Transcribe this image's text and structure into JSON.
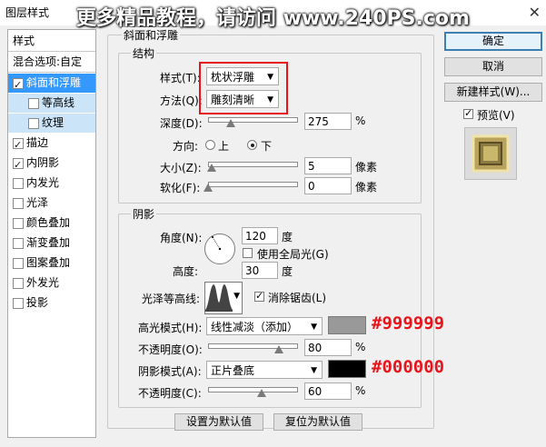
{
  "window": {
    "title": "图层样式",
    "watermark": "更多精品教程，请访问 www.240PS.com",
    "close_glyph": "✕"
  },
  "left_panel": {
    "header": "样式",
    "items": [
      {
        "label": "混合选项:自定",
        "checkbox": false,
        "checked": false
      },
      {
        "label": "斜面和浮雕",
        "checkbox": true,
        "checked": true,
        "selected": true
      },
      {
        "label": "等高线",
        "checkbox": true,
        "checked": false,
        "sub": true
      },
      {
        "label": "纹理",
        "checkbox": true,
        "checked": false,
        "sub": true
      },
      {
        "label": "描边",
        "checkbox": true,
        "checked": true
      },
      {
        "label": "内阴影",
        "checkbox": true,
        "checked": true
      },
      {
        "label": "内发光",
        "checkbox": true,
        "checked": false
      },
      {
        "label": "光泽",
        "checkbox": true,
        "checked": false
      },
      {
        "label": "颜色叠加",
        "checkbox": true,
        "checked": false
      },
      {
        "label": "渐变叠加",
        "checkbox": true,
        "checked": false
      },
      {
        "label": "图案叠加",
        "checkbox": true,
        "checked": false
      },
      {
        "label": "外发光",
        "checkbox": true,
        "checked": false
      },
      {
        "label": "投影",
        "checkbox": true,
        "checked": false
      }
    ]
  },
  "bevel": {
    "group_title": "斜面和浮雕",
    "structure": {
      "title": "结构",
      "style_label": "样式(T):",
      "style_value": "枕状浮雕",
      "method_label": "方法(Q):",
      "method_value": "雕刻清晰",
      "depth_label": "深度(D):",
      "depth_value": "275",
      "depth_fraction": 0.275,
      "percent": "%",
      "direction_label": "方向:",
      "dir_up": "上",
      "dir_down": "下",
      "direction_selected": "下",
      "size_label": "大小(Z):",
      "size_value": "5",
      "soften_label": "软化(F):",
      "soften_value": "0",
      "unit_px": "像素"
    },
    "shading": {
      "title": "阴影",
      "angle_label": "角度(N):",
      "angle_value": "120",
      "degree": "度",
      "global_light_label": "使用全局光(G)",
      "global_light_checked": false,
      "altitude_label": "高度:",
      "altitude_value": "30",
      "gloss_label": "光泽等高线:",
      "antialias_label": "消除锯齿(L)",
      "antialias_checked": true,
      "highlight_mode_label": "高光模式(H):",
      "highlight_mode_value": "线性减淡（添加）",
      "highlight_color": "#999999",
      "highlight_annotation": "#999999",
      "highlight_opacity_label": "不透明度(O):",
      "highlight_opacity_value": "80",
      "highlight_opacity_fraction": 0.8,
      "shadow_mode_label": "阴影模式(A):",
      "shadow_mode_value": "正片叠底",
      "shadow_color": "#000000",
      "shadow_annotation": "#000000",
      "shadow_opacity_label": "不透明度(C):",
      "shadow_opacity_value": "60",
      "shadow_opacity_fraction": 0.6,
      "percent": "%"
    },
    "make_default": "设置为默认值",
    "reset_default": "复位为默认值"
  },
  "right_panel": {
    "ok": "确定",
    "cancel": "取消",
    "new_style": "新建样式(W)...",
    "preview_label": "预览(V)",
    "preview_checked": true
  },
  "colors": {
    "annotation_red": "#e8141b",
    "selection_blue": "#3399ff"
  }
}
